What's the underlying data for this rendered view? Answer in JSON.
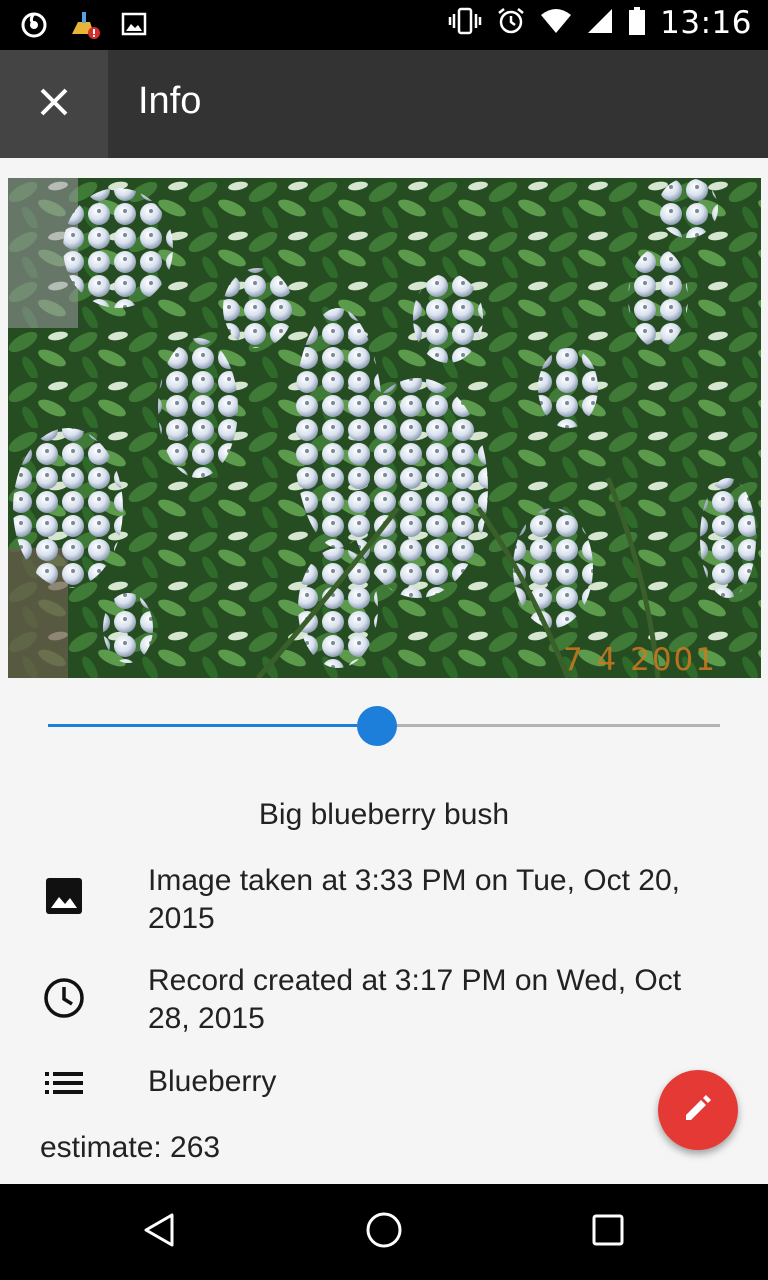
{
  "status_bar": {
    "time": "13:16",
    "left_icons": [
      "hotspot-icon",
      "cleaner-alert-icon",
      "image-notification-icon"
    ],
    "right_icons": [
      "vibrate-icon",
      "alarm-icon",
      "wifi-icon",
      "signal-icon",
      "battery-icon"
    ]
  },
  "app_bar": {
    "title": "Info",
    "close_icon": "close-icon"
  },
  "photo": {
    "date_stamp": "7  4  2001"
  },
  "slider": {
    "value": 0.49
  },
  "caption": "Big blueberry bush",
  "details": [
    {
      "icon": "image-icon",
      "text": "Image taken at 3:33 PM on Tue, Oct 20, 2015"
    },
    {
      "icon": "clock-icon",
      "text": "Record created at 3:17 PM on Wed, Oct 28, 2015"
    },
    {
      "icon": "list-icon",
      "text": "Blueberry"
    }
  ],
  "estimate": "estimate: 263",
  "fab": {
    "icon": "edit-pencil-icon"
  },
  "nav_bar": {
    "buttons": [
      "back-icon",
      "home-icon",
      "recents-icon"
    ]
  },
  "colors": {
    "accent": "#1e7fdb",
    "fab": "#e53935",
    "app_bar": "#333333"
  }
}
